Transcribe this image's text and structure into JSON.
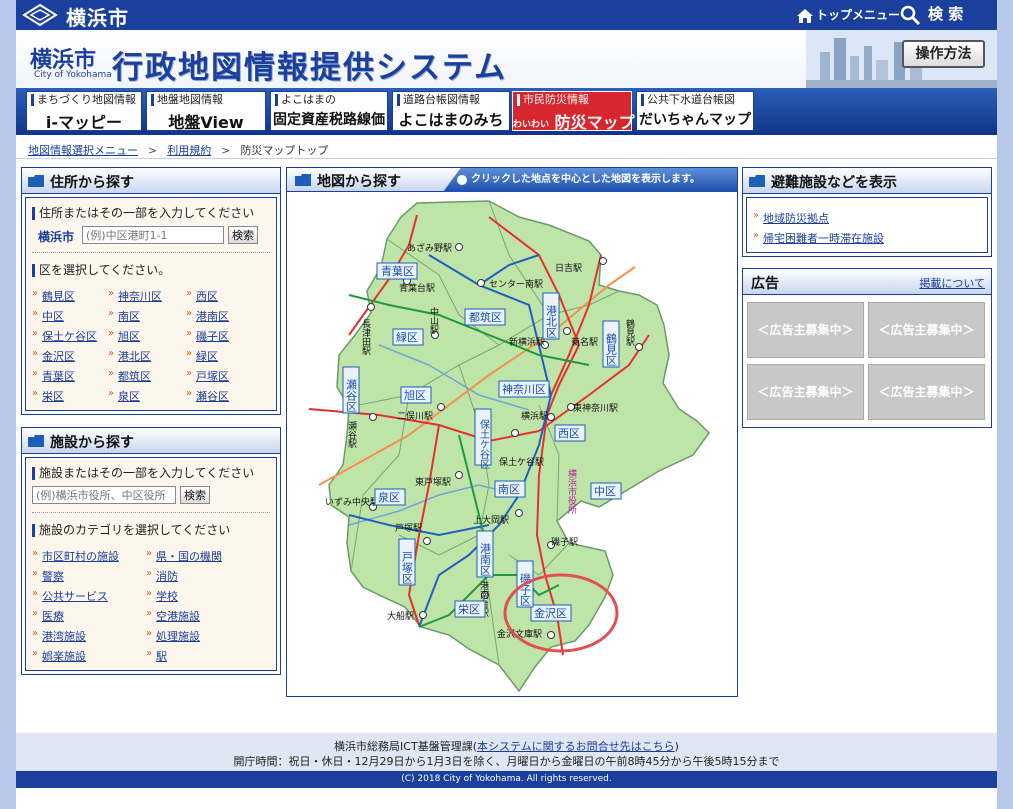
{
  "header": {
    "city_name": "横浜市",
    "top_menu_label": "トップメニュー",
    "search_label": "検 索"
  },
  "banner": {
    "logo_text": "横浜市",
    "logo_sub": "City of Yokohama",
    "title": "行政地図情報提供システム",
    "howto_button": "操作方法"
  },
  "tabs": [
    {
      "sub": "まちづくり地図情報",
      "main": "i-マッピー"
    },
    {
      "sub": "地盤地図情報",
      "main": "地盤View"
    },
    {
      "sub": "よこはまの",
      "main": "固定資産税路線価"
    },
    {
      "sub": "道路台帳図情報",
      "main": "よこはまのみち"
    },
    {
      "sub": "市民防災情報",
      "main": "防災マップ",
      "prefix": "わいわい"
    },
    {
      "sub": "公共下水道台帳図",
      "main": "だいちゃんマップ"
    }
  ],
  "breadcrumb": {
    "item1": "地図情報選択メニュー",
    "item2": "利用規約",
    "current": "防災マップトップ",
    "sep": ">"
  },
  "address_panel": {
    "title": "住所から探す",
    "instruction": "住所またはその一部を入力してください",
    "prefix": "横浜市",
    "placeholder": "(例)中区港町1-1",
    "search_button": "検索",
    "ward_instruction": "区を選択してください。",
    "wards": [
      "鶴見区",
      "神奈川区",
      "西区",
      "中区",
      "南区",
      "港南区",
      "保土ケ谷区",
      "旭区",
      "磯子区",
      "金沢区",
      "港北区",
      "緑区",
      "青葉区",
      "都筑区",
      "戸塚区",
      "栄区",
      "泉区",
      "瀬谷区"
    ]
  },
  "facility_panel": {
    "title": "施設から探す",
    "instruction": "施設またはその一部を入力してください",
    "placeholder": "(例)横浜市役所、中区役所",
    "search_button": "検索",
    "category_instruction": "施設のカテゴリを選択してください",
    "categories": [
      "市区町村の施設",
      "県・国の機関",
      "警察",
      "消防",
      "公共サービス",
      "学校",
      "医療",
      "空港施設",
      "港湾施設",
      "処理施設",
      "娯楽施設",
      "駅"
    ]
  },
  "map_panel": {
    "title": "地図から探す",
    "tip": "クリックした地点を中心とした地図を表示します。",
    "wards": [
      "青葉区",
      "緑区",
      "都筑区",
      "港北区",
      "鶴見区",
      "瀬谷区",
      "旭区",
      "神奈川区",
      "保土ケ谷区",
      "西区",
      "南区",
      "中区",
      "泉区",
      "戸塚区",
      "港南区",
      "磯子区",
      "栄区",
      "金沢区"
    ],
    "stations": [
      "あざみ野駅",
      "青葉台駅",
      "センター南駅",
      "日吉駅",
      "長津田駅",
      "中山駅",
      "新横浜駅",
      "菊名駅",
      "鶴見駅",
      "二俣川駅",
      "横浜駅",
      "東神奈川駅",
      "瀬谷駅",
      "保土ケ谷駅",
      "東戸塚駅",
      "いずみ中央駅",
      "戸塚駅",
      "上大岡駅",
      "磯子駅",
      "大船駅",
      "港南台駅",
      "金沢文庫駅"
    ],
    "city_hall": "横浜市役所"
  },
  "evac_panel": {
    "title": "避難施設などを表示",
    "links": [
      "地域防災拠点",
      "帰宅困難者一時滞在施設"
    ]
  },
  "ad_panel": {
    "title": "広告",
    "about_link": "掲載について",
    "slots": [
      "＜広告主募集中＞",
      "＜広告主募集中＞",
      "＜広告主募集中＞",
      "＜広告主募集中＞"
    ]
  },
  "footer": {
    "line1_prefix": "横浜市総務局ICT基盤管理課(",
    "line1_link": "本システムに関するお問合せ先はこちら",
    "line1_suffix": ")",
    "line2": "開庁時間：祝日・休日・12月29日から1月3日を除く、月曜日から金曜日の午前8時45分から午後5時15分まで",
    "copyright": "(C) 2018 City of Yokohama. All rights reserved."
  }
}
